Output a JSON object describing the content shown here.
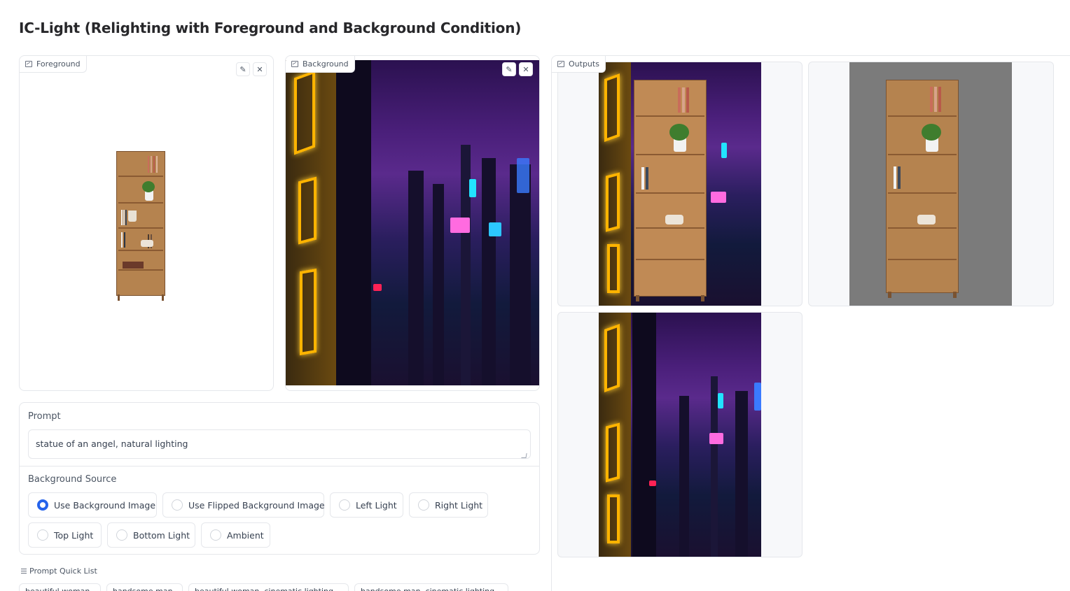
{
  "app": {
    "title": "IC-Light (Relighting with Foreground and Background Condition)"
  },
  "foreground": {
    "label": "Foreground",
    "edit_icon": "pencil-icon",
    "close_icon": "close-icon"
  },
  "background": {
    "label": "Background",
    "edit_icon": "pencil-icon",
    "close_icon": "close-icon"
  },
  "outputs": {
    "label": "Outputs"
  },
  "prompt": {
    "label": "Prompt",
    "value": "statue of an angel, natural lighting"
  },
  "bg_source": {
    "label": "Background Source",
    "options": [
      {
        "label": "Use Background Image",
        "selected": true
      },
      {
        "label": "Use Flipped Background Image",
        "selected": false
      },
      {
        "label": "Left Light",
        "selected": false
      },
      {
        "label": "Right Light",
        "selected": false
      },
      {
        "label": "Top Light",
        "selected": false
      },
      {
        "label": "Bottom Light",
        "selected": false
      },
      {
        "label": "Ambient",
        "selected": false
      }
    ]
  },
  "quick_list": {
    "label": "Prompt Quick List",
    "chips": [
      "beautiful woman",
      "handsome man",
      "beautiful woman, cinematic lighting",
      "handsome man, cinematic lighting"
    ]
  },
  "colors": {
    "accent": "#2563eb",
    "border": "#e5e7eb",
    "neon": "#ffb400",
    "gray_bg": "#7b7b7b"
  }
}
